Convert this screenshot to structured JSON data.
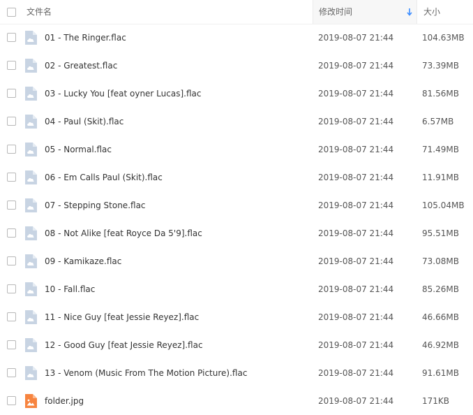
{
  "header": {
    "name_label": "文件名",
    "date_label": "修改时间",
    "size_label": "大小",
    "sort_icon": "arrow-down-icon",
    "sort_color": "#3b8cff"
  },
  "colors": {
    "audio_icon": "#c8d4e3",
    "image_icon": "#f7843f"
  },
  "files": [
    {
      "name": "01 - The Ringer.flac",
      "date": "2019-08-07 21:44",
      "size": "104.63MB",
      "type": "audio"
    },
    {
      "name": "02 - Greatest.flac",
      "date": "2019-08-07 21:44",
      "size": "73.39MB",
      "type": "audio"
    },
    {
      "name": "03 - Lucky You [feat oyner Lucas].flac",
      "date": "2019-08-07 21:44",
      "size": "81.56MB",
      "type": "audio"
    },
    {
      "name": "04 - Paul (Skit).flac",
      "date": "2019-08-07 21:44",
      "size": "6.57MB",
      "type": "audio"
    },
    {
      "name": "05 - Normal.flac",
      "date": "2019-08-07 21:44",
      "size": "71.49MB",
      "type": "audio"
    },
    {
      "name": "06 - Em Calls Paul (Skit).flac",
      "date": "2019-08-07 21:44",
      "size": "11.91MB",
      "type": "audio"
    },
    {
      "name": "07 - Stepping Stone.flac",
      "date": "2019-08-07 21:44",
      "size": "105.04MB",
      "type": "audio"
    },
    {
      "name": "08 - Not Alike [feat Royce Da 5'9].flac",
      "date": "2019-08-07 21:44",
      "size": "95.51MB",
      "type": "audio"
    },
    {
      "name": "09 - Kamikaze.flac",
      "date": "2019-08-07 21:44",
      "size": "73.08MB",
      "type": "audio"
    },
    {
      "name": "10 - Fall.flac",
      "date": "2019-08-07 21:44",
      "size": "85.26MB",
      "type": "audio"
    },
    {
      "name": "11 - Nice Guy [feat Jessie Reyez].flac",
      "date": "2019-08-07 21:44",
      "size": "46.66MB",
      "type": "audio"
    },
    {
      "name": "12 - Good Guy [feat Jessie Reyez].flac",
      "date": "2019-08-07 21:44",
      "size": "46.92MB",
      "type": "audio"
    },
    {
      "name": "13 - Venom (Music From The Motion Picture).flac",
      "date": "2019-08-07 21:44",
      "size": "91.61MB",
      "type": "audio"
    },
    {
      "name": "folder.jpg",
      "date": "2019-08-07 21:44",
      "size": "171KB",
      "type": "image"
    }
  ]
}
